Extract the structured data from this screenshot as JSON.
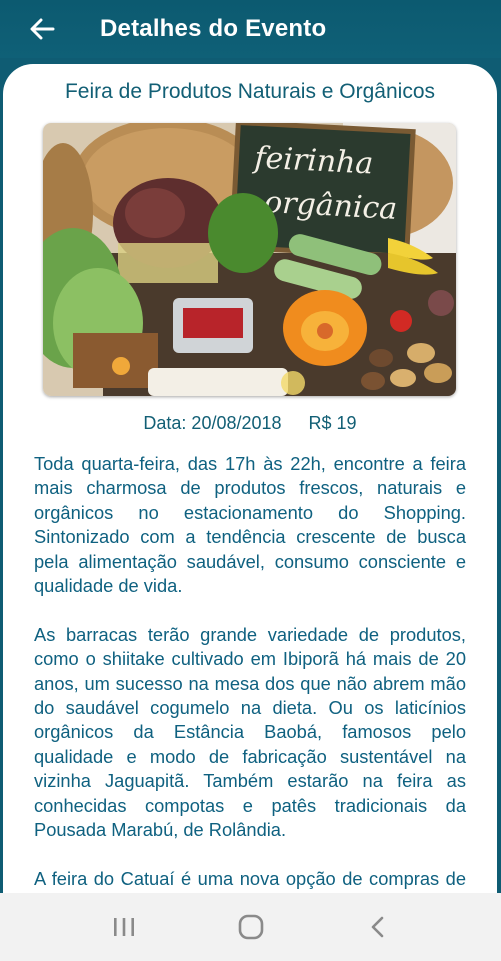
{
  "appbar": {
    "title": "Detalhes do Evento",
    "back_icon": "arrow-left-icon"
  },
  "event": {
    "title": "Feira de Produtos Naturais e Orgânicos",
    "image_sign_text": [
      "feirinha",
      "orgânica"
    ],
    "date_label": "Data: 20/08/2018",
    "price_label": "R$ 19",
    "description": [
      "Toda quarta-feira, das 17h às 22h, encontre a feira mais charmosa de produtos frescos, naturais e orgânicos no estacionamento do Shopping. Sintonizado com a tendência crescente de busca pela alimentação saudável, consumo consciente e qualidade de vida.",
      "As barracas terão grande variedade de produtos, como o shiitake cultivado em Ibiporã há mais de 20 anos, um sucesso na mesa dos que não abrem mão do saudável cogumelo na dieta. Ou os laticínios orgânicos da Estância Baobá, famosos pelo qualidade e modo de fabricação sustentável na vizinha Jaguapitã. Também estarão na feira as conhecidas compotas e patês tradicionais da Pousada Marabú, de Rolândia.",
      "A feira do Catuaí é uma nova opção de compras de produtos que não são facilmente encontrados"
    ]
  },
  "navbar": {
    "recents_icon": "recent-apps-icon",
    "home_icon": "home-icon",
    "back_icon": "back-chevron-icon"
  },
  "colors": {
    "appbar": "#0f5c73",
    "text_primary": "#125f75",
    "card": "#ffffff",
    "navbar": "#f2f2f2"
  }
}
